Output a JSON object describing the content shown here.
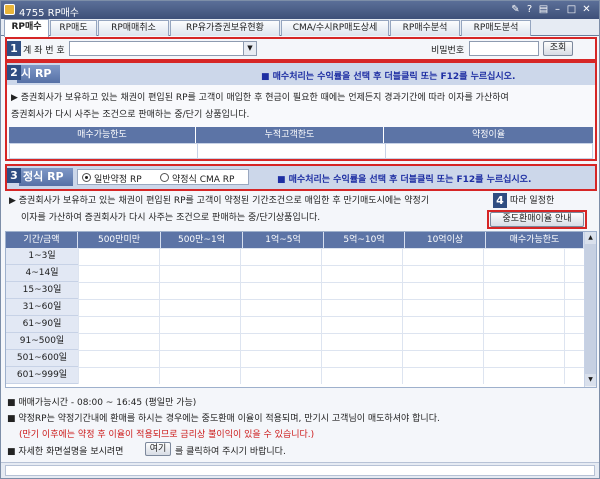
{
  "window": {
    "title": "4755 RP매수"
  },
  "tabs": [
    "RP매수",
    "RP매도",
    "RP매매취소",
    "RP유가증권보유현황",
    "CMA/수시RP매도상세",
    "RP매수분석",
    "RP매도분석"
  ],
  "account": {
    "label": "계 좌 번 호",
    "password_label": "비밀번호",
    "query_button": "조회"
  },
  "callouts": [
    "1",
    "2",
    "3",
    "4"
  ],
  "section_free": {
    "title": "시 RP",
    "notice": "■ 매수처리는 수익률을 선택 후 더블클릭 또는 F12를 누르십시오.",
    "desc_line1": "▶ 증권회사가 보유하고 있는 채권이 편입된 RP를 고객이 매입한 후 현금이 필요한 때에는 언제든지 경과기간에 따라 이자를 가산하여",
    "desc_line2": "증권회사가 다시 사주는 조건으로 판매하는 중/단기 상품입니다.",
    "columns": [
      "매수가능한도",
      "누적고객한도",
      "약정이율"
    ]
  },
  "section_fixed": {
    "title": "정식 RP",
    "radio_general": "일반약정 RP",
    "radio_cma": "약정식 CMA RP",
    "notice": "■ 매수처리는 수익률을 선택 후 더블클릭 또는 F12를 누르십시오.",
    "desc_line1a": "▶ 증권회사가 보유하고 있는 채권이 편입된 RP를 고객이 약정된 기간조건으로 매입한 후 만기매도시에는 약정기",
    "desc_line1b": "따라 일정한",
    "desc_line2": "이자를 가산하여 증권회사가 다시 사주는 조건으로 판매하는 중/단기상품입니다.",
    "guide_button": "중도환매이율 안내"
  },
  "rate_table": {
    "headers": [
      "기간/금액",
      "500만미만",
      "500만~1억",
      "1억~5억",
      "5억~10억",
      "10억이상",
      "매수가능한도"
    ],
    "rows": [
      "1~3일",
      "4~14일",
      "15~30일",
      "31~60일",
      "61~90일",
      "91~500일",
      "501~600일",
      "601~999일"
    ]
  },
  "footer": {
    "line1": "■ 매매가능시간 - 08:00 ~ 16:45 (평일만 가능)",
    "line2": "■ 약정RP는 약정기간내에 환매를 하시는 경우에는 중도환매 이율이 적용되며, 만기시 고객님이 매도하셔야 합니다.",
    "line3": "(만기 이후에는 약정 후 이율이 적용되므로 금리상 불이익이 있을 수 있습니다.)",
    "line4a": "■ 자세한 화면설명을 보시려면",
    "here_button": "여기",
    "line4b": "를 클릭하여 주시기 바랍니다."
  },
  "colors": {
    "title_bar": "#3e5079",
    "section_border": "#d62626",
    "header_fill": "#5c74a6",
    "notice_text": "#1e2fa3",
    "warning_text": "#cc1a1a"
  }
}
